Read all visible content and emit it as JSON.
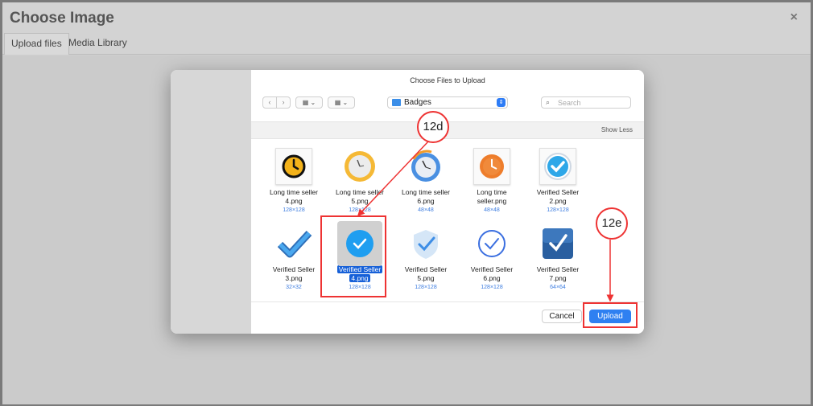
{
  "app": {
    "title": "Choose Image",
    "close_glyph": "×"
  },
  "tabs": [
    {
      "label": "Upload files"
    },
    {
      "label": "Media Library"
    }
  ],
  "dialog": {
    "title": "Choose Files to Upload",
    "nav_back": "‹",
    "nav_forward": "›",
    "view_grid_label": "▦ ⌄",
    "view_group_label": "▦ ⌄",
    "folder": "Badges",
    "search_placeholder": "Search",
    "show_less": "Show Less",
    "cancel_label": "Cancel",
    "upload_label": "Upload",
    "files": [
      {
        "name_line1": "Long time seller",
        "name_line2": "4.png",
        "dims": "128×128",
        "icon": "clock-black-icon"
      },
      {
        "name_line1": "Long time seller",
        "name_line2": "5.png",
        "dims": "128×128",
        "icon": "clock-gold-icon"
      },
      {
        "name_line1": "Long time seller",
        "name_line2": "6.png",
        "dims": "48×48",
        "icon": "clock-blue-icon"
      },
      {
        "name_line1": "Long time",
        "name_line2": "seller.png",
        "dims": "48×48",
        "icon": "clock-orange-icon"
      },
      {
        "name_line1": "Verified Seller",
        "name_line2": "2.png",
        "dims": "128×128",
        "icon": "verified-badge-icon"
      },
      {
        "name_line1": "Verified Seller",
        "name_line2": "3.png",
        "dims": "32×32",
        "icon": "checkmark-icon"
      },
      {
        "name_line1": "Verified Seller",
        "name_line2": "4.png",
        "dims": "128×128",
        "icon": "check-circle-icon",
        "selected": true
      },
      {
        "name_line1": "Verified Seller",
        "name_line2": "5.png",
        "dims": "128×128",
        "icon": "shield-check-icon"
      },
      {
        "name_line1": "Verified Seller",
        "name_line2": "6.png",
        "dims": "128×128",
        "icon": "check-outline-icon"
      },
      {
        "name_line1": "Verified Seller",
        "name_line2": "7.png",
        "dims": "64×64",
        "icon": "check-square-icon"
      }
    ]
  },
  "annotations": {
    "a1": "12d",
    "a2": "12e",
    "color": "#e33333"
  },
  "colors": {
    "accent": "#2f80f1",
    "selection": "#1660d8"
  }
}
